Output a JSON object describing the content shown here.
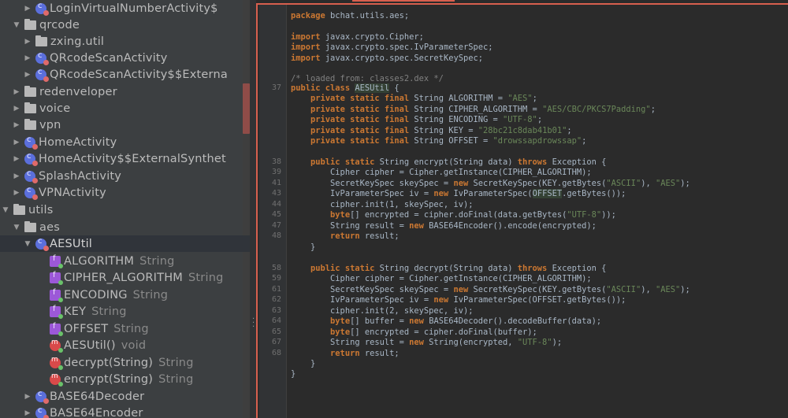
{
  "tree": {
    "rows": [
      {
        "label": "LoginVirtualNumberActivity$",
        "type": ""
      },
      {
        "label": "qrcode",
        "type": ""
      },
      {
        "label": "zxing.util",
        "type": ""
      },
      {
        "label": "QRcodeScanActivity",
        "type": ""
      },
      {
        "label": "QRcodeScanActivity$$Externa",
        "type": ""
      },
      {
        "label": "redenveloper",
        "type": ""
      },
      {
        "label": "voice",
        "type": ""
      },
      {
        "label": "vpn",
        "type": ""
      },
      {
        "label": "HomeActivity",
        "type": ""
      },
      {
        "label": "HomeActivity$$ExternalSynthet",
        "type": ""
      },
      {
        "label": "SplashActivity",
        "type": ""
      },
      {
        "label": "VPNActivity",
        "type": ""
      },
      {
        "label": "utils",
        "type": ""
      },
      {
        "label": "aes",
        "type": ""
      },
      {
        "label": "AESUtil",
        "type": ""
      },
      {
        "label": "ALGORITHM",
        "type": "String"
      },
      {
        "label": "CIPHER_ALGORITHM",
        "type": "String"
      },
      {
        "label": "ENCODING",
        "type": "String"
      },
      {
        "label": "KEY",
        "type": "String"
      },
      {
        "label": "OFFSET",
        "type": "String"
      },
      {
        "label": "AESUtil()",
        "type": "void"
      },
      {
        "label": "decrypt(String)",
        "type": "String"
      },
      {
        "label": "encrypt(String)",
        "type": "String"
      },
      {
        "label": "BASE64Decoder",
        "type": ""
      },
      {
        "label": "BASE64Encoder",
        "type": ""
      }
    ]
  },
  "gutter": {
    "numbers": [
      "37",
      "38",
      "39",
      "41",
      "43",
      "44",
      "45",
      "47",
      "48",
      "58",
      "59",
      "61",
      "62",
      "63",
      "64",
      "65",
      "67",
      "68"
    ]
  },
  "code": {
    "package": "bchat.utils.aes;",
    "imports": [
      "javax.crypto.Cipher;",
      "javax.crypto.spec.IvParameterSpec;",
      "javax.crypto.spec.SecretKeySpec;"
    ],
    "loaded_comment": "/* loaded from: classes2.dex */",
    "class_name": "AESUtil",
    "fields": [
      {
        "name": "ALGORITHM",
        "value": "\"AES\""
      },
      {
        "name": "CIPHER_ALGORITHM",
        "value": "\"AES/CBC/PKCS7Padding\""
      },
      {
        "name": "ENCODING",
        "value": "\"UTF-8\""
      },
      {
        "name": "KEY",
        "value": "\"28bc21c8dab41b01\""
      },
      {
        "name": "OFFSET",
        "value": "\"drowssapdrowssap\""
      }
    ]
  },
  "colors": {
    "accent": "#d75f4e",
    "keyword": "#cc7832",
    "string": "#6a8759",
    "comment": "#808080",
    "text": "#a9b7c6"
  }
}
